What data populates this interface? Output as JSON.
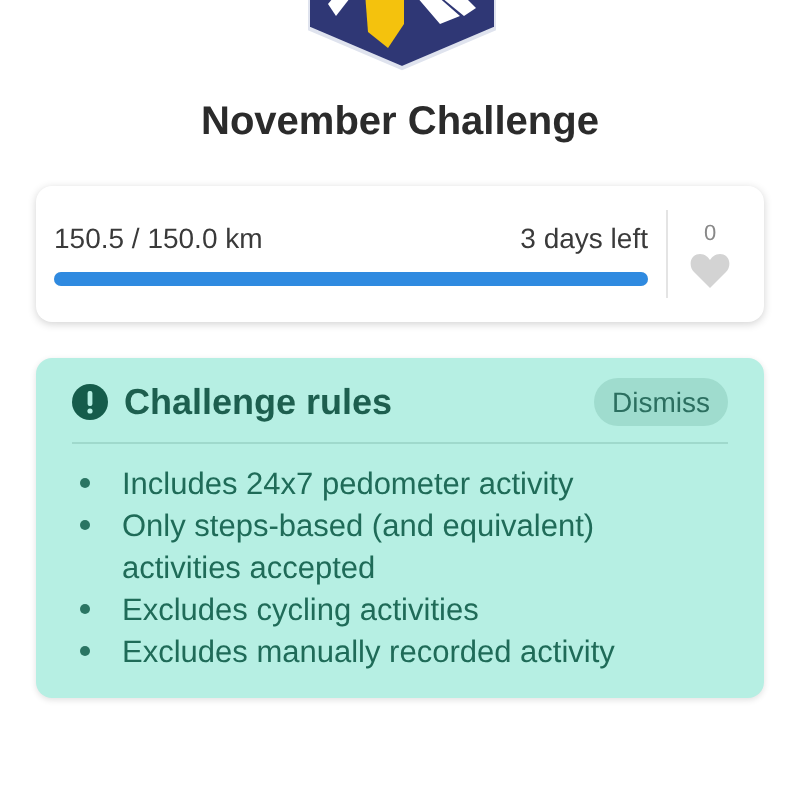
{
  "title": "November Challenge",
  "progress": {
    "distance": "150.5 / 150.0 km",
    "time_left": "3 days left",
    "level": 1.0,
    "likes": "0",
    "liked": false
  },
  "rules": {
    "title": "Challenge rules",
    "dismiss": "Dismiss",
    "items": [
      "Includes 24x7 pedometer activity",
      "Only steps-based (and equivalent) activities accepted",
      "Excludes cycling activities",
      "Excludes manually recorded activity"
    ]
  }
}
